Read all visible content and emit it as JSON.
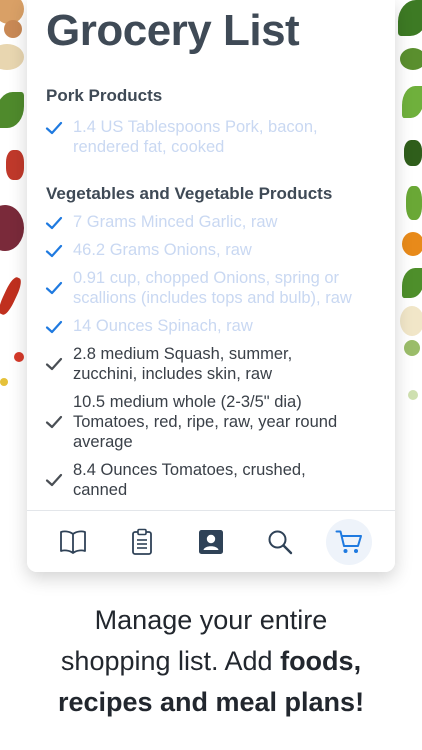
{
  "app": {
    "title": "Grocery List"
  },
  "sections": [
    {
      "header": "Pork Products",
      "items": [
        {
          "line1": "1.4 US Tablespoons Pork, bacon,",
          "line2": "rendered fat, cooked",
          "checked": true
        }
      ]
    },
    {
      "header": "Vegetables and Vegetable Products",
      "items": [
        {
          "line1": "7 Grams Minced Garlic, raw",
          "checked": true
        },
        {
          "line1": "46.2 Grams Onions, raw",
          "checked": true
        },
        {
          "line1": "0.91 cup, chopped Onions, spring or",
          "line2": "scallions (includes tops and bulb), raw",
          "checked": true
        },
        {
          "line1": "14 Ounces Spinach, raw",
          "checked": true
        },
        {
          "line1": "2.8 medium Squash, summer,",
          "line2": "zucchini, includes skin, raw",
          "checked": false
        },
        {
          "line1": "10.5 medium whole (2-3/5\" dia)",
          "line2": "Tomatoes, red, ripe, raw, year round",
          "line3": "average",
          "checked": false
        },
        {
          "line1": "8.4 Ounces Tomatoes, crushed,",
          "line2": "canned",
          "checked": false
        }
      ]
    }
  ],
  "tabbar": {
    "tabs": [
      {
        "icon": "book-icon",
        "active": false
      },
      {
        "icon": "clipboard-icon",
        "active": false
      },
      {
        "icon": "contact-icon",
        "active": false
      },
      {
        "icon": "search-icon",
        "active": false
      },
      {
        "icon": "cart-icon",
        "active": true
      }
    ]
  },
  "caption": {
    "line1": "Manage your entire",
    "line2_plain": "shopping list. Add ",
    "line2_bold": "foods,",
    "line3_bold": "recipes and meal plans!"
  },
  "colors": {
    "accent": "#1f7ae0",
    "checked_text": "#c9d8f2",
    "title": "#3f4a56"
  }
}
